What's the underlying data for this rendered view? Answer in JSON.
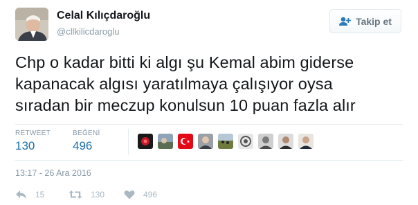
{
  "user": {
    "name": "Celal Kılıçdaroğlu",
    "handle": "@cllkilicdaroglu"
  },
  "follow_button": {
    "label": "Takip et",
    "icon": "add-user-icon"
  },
  "tweet": {
    "lines": [
      "Chp o kadar bitti ki algı şu Kemal abim giderse",
      "kapanacak algısı yaratılmaya çalışıyor oysa",
      "sıradan bir meczup konulsun 10 puan fazla alır"
    ],
    "timestamp": "13:17 - 26 Ara 2016"
  },
  "stats": {
    "retweet_label": "RETWEET",
    "retweet_count": "130",
    "like_label": "BEĞENİ",
    "like_count": "496"
  },
  "actions": {
    "reply_count": "15",
    "retweet_count": "130",
    "like_count": "496"
  },
  "colors": {
    "link_blue": "#1b6fa8",
    "muted_gray": "#8899a6",
    "icon_gray": "#aab8c2",
    "divider": "#e6ecf0"
  }
}
